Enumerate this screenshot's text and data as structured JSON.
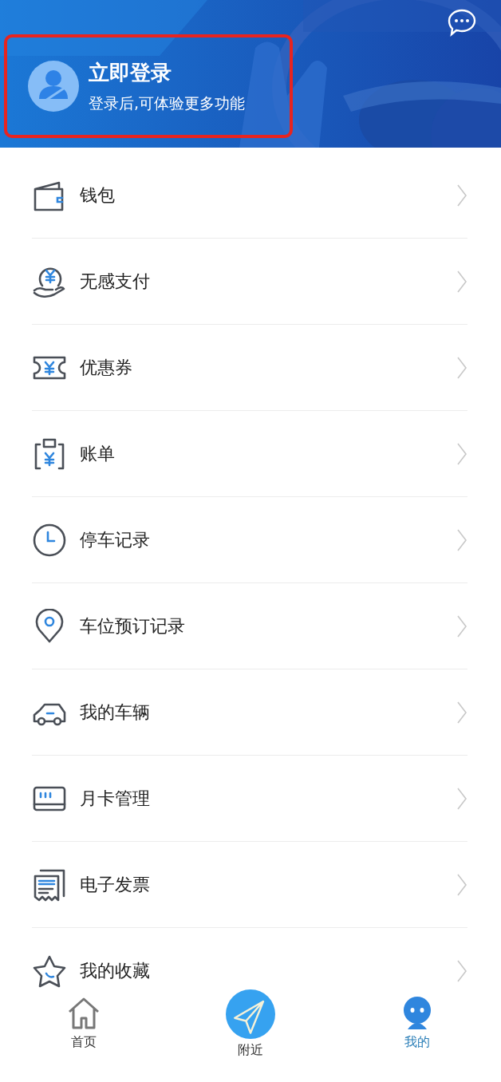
{
  "header": {
    "login": {
      "title": "立即登录",
      "subtitle": "登录后,可体验更多功能",
      "highlighted": true
    }
  },
  "menu": [
    {
      "label": "钱包"
    },
    {
      "label": "无感支付"
    },
    {
      "label": "优惠券"
    },
    {
      "label": "账单"
    },
    {
      "label": "停车记录"
    },
    {
      "label": "车位预订记录"
    },
    {
      "label": "我的车辆"
    },
    {
      "label": "月卡管理"
    },
    {
      "label": "电子发票"
    },
    {
      "label": "我的收藏"
    }
  ],
  "tabs": [
    {
      "label": "首页",
      "selected": false
    },
    {
      "label": "附近",
      "selected": false
    },
    {
      "label": "我的",
      "selected": true
    }
  ]
}
